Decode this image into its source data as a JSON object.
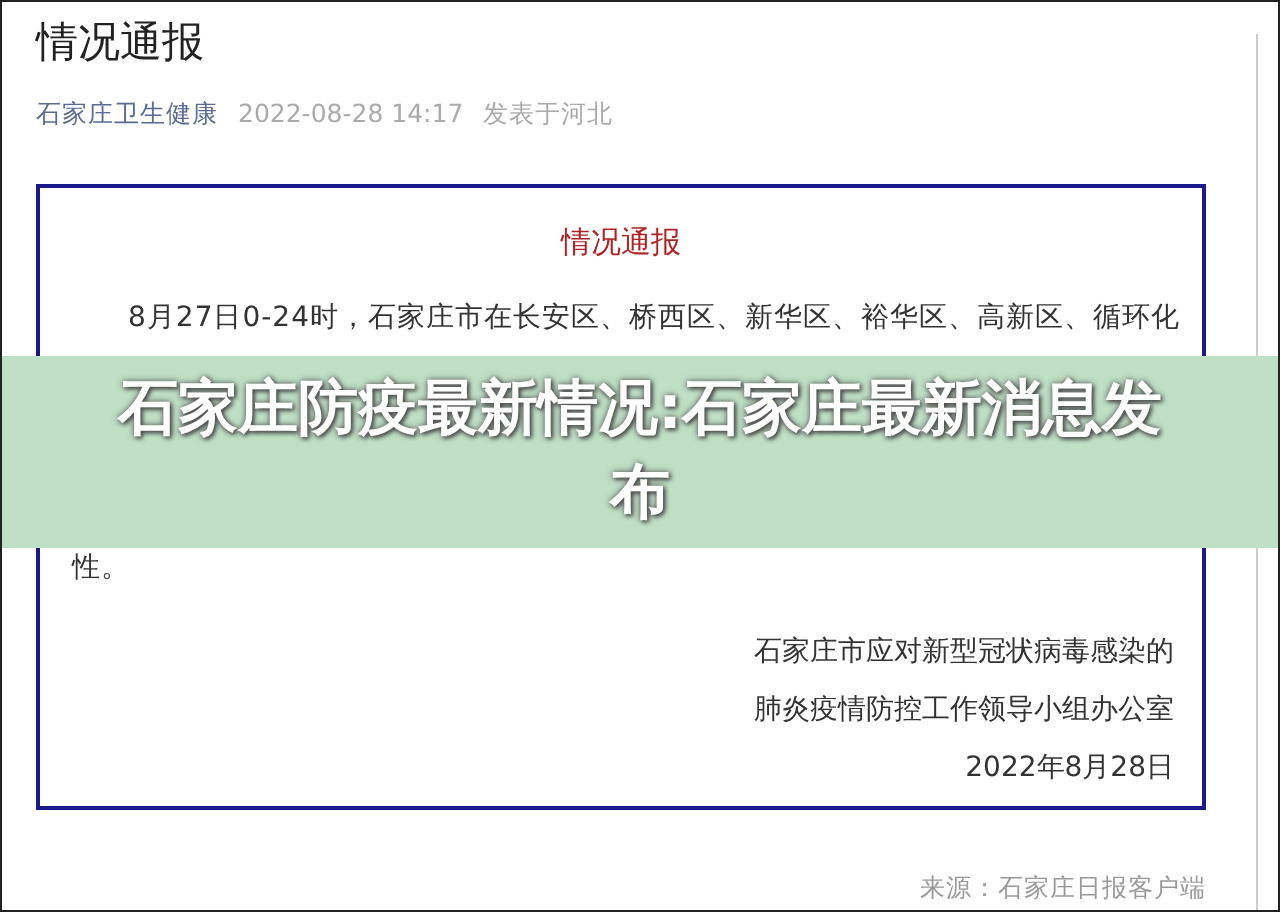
{
  "article": {
    "title": "情况通报",
    "author": "石家庄卫生健康",
    "date": "2022-08-28 14:17",
    "location": "发表于河北"
  },
  "notice": {
    "heading": "情况通报",
    "lines": [
      "8月27日0-24时，石家庄市在长安区、桥西区、新华区、裕华区、高新区、循环化",
      "性。"
    ],
    "signature": [
      "石家庄市应对新型冠状病毒感染的",
      "肺炎疫情防控工作领导小组办公室",
      "2022年8月28日"
    ]
  },
  "source": "来源：石家庄日报客户端",
  "banner": {
    "title": "石家庄防疫最新情况:石家庄最新消息发布"
  }
}
